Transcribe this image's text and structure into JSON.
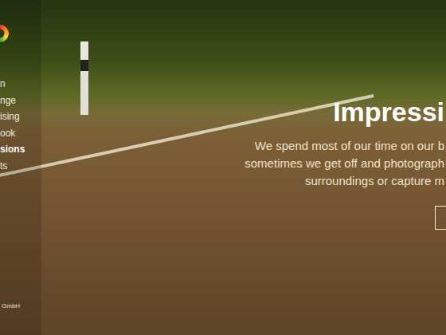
{
  "sidebar": {
    "items": [
      {
        "label": "n",
        "selected": false
      },
      {
        "label": "nge",
        "selected": false
      },
      {
        "label": "ising",
        "selected": false
      },
      {
        "label": "ook",
        "selected": false
      },
      {
        "label": "sions",
        "selected": true
      },
      {
        "label": "ts",
        "selected": false
      }
    ],
    "footer": "GmbH"
  },
  "hero": {
    "title": "Impressi",
    "lines": [
      "We spend most of our time on our b",
      "sometimes we get off and photograph",
      "surroundings or capture m"
    ]
  }
}
